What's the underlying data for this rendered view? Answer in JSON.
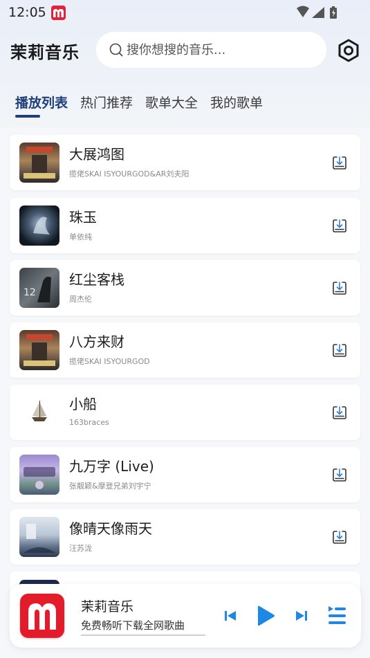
{
  "status_bar": {
    "time": "12:05"
  },
  "header": {
    "title": "茉莉音乐",
    "search_placeholder": "搜你想搜的音乐..."
  },
  "tabs": [
    {
      "label": "播放列表",
      "active": true
    },
    {
      "label": "热门推荐",
      "active": false
    },
    {
      "label": "歌单大全",
      "active": false
    },
    {
      "label": "我的歌单",
      "active": false
    }
  ],
  "songs": [
    {
      "title": "大展鸿图",
      "artist": "揽佬SKAI ISYOURGOD&AR刘夫阳"
    },
    {
      "title": "珠玉",
      "artist": "单依纯"
    },
    {
      "title": "红尘客栈",
      "artist": "周杰伦"
    },
    {
      "title": "八方来财",
      "artist": "揽佬SKAI ISYOURGOD"
    },
    {
      "title": "小船",
      "artist": "163braces"
    },
    {
      "title": "九万字 (Live)",
      "artist": "张靓颖&摩登兄弟刘宇宁"
    },
    {
      "title": "像晴天像雨天",
      "artist": "汪苏泷"
    }
  ],
  "player": {
    "title": "茉莉音乐",
    "subtitle": "免费畅听下载全网歌曲",
    "progress": 0
  },
  "colors": {
    "accent": "#1f3f7a",
    "brand_red": "#e31b2b",
    "control_blue": "#1e88e5"
  }
}
